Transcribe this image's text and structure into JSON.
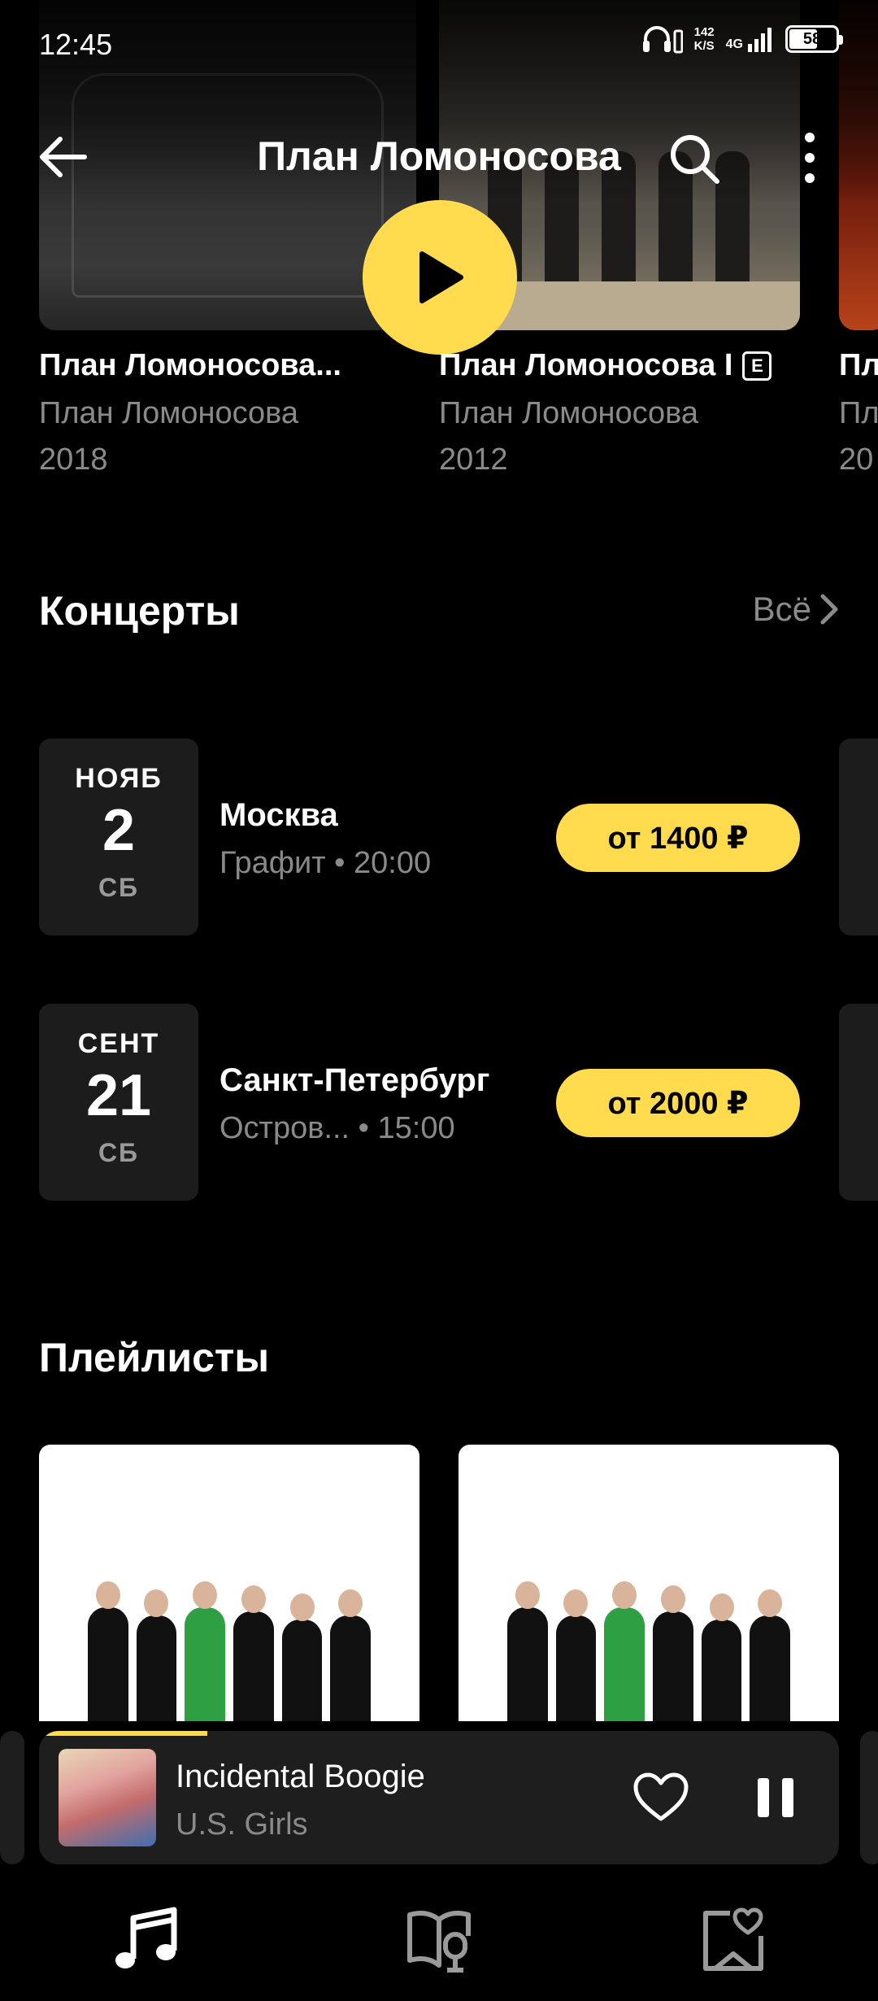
{
  "status_bar": {
    "time": "12:45",
    "speed_value": "142",
    "speed_unit": "K/S",
    "network": "4G",
    "battery": "58"
  },
  "header": {
    "title": "План Ломоносова"
  },
  "albums": [
    {
      "title": "План Ломоносова...",
      "artist": "План Ломоносова",
      "year": "2018",
      "explicit": false
    },
    {
      "title": "План Ломоносова I",
      "artist": "План Ломоносова",
      "year": "2012",
      "explicit": true,
      "explicit_badge": "E"
    },
    {
      "title": "Пл",
      "artist": "Пл",
      "year": "20",
      "explicit": false
    }
  ],
  "concerts_section": {
    "title": "Концерты",
    "see_all": "Всё"
  },
  "concerts": [
    {
      "month": "НОЯБ",
      "day": "2",
      "weekday": "СБ",
      "city": "Москва",
      "venue": "Графит • 20:00",
      "price": "от 1400 ₽"
    },
    {
      "month": "СЕНТ",
      "day": "21",
      "weekday": "СБ",
      "city": "Санкт-Петербург",
      "venue": "Остров... • 15:00",
      "price": "от 2000 ₽"
    }
  ],
  "playlists_section": {
    "title": "Плейлисты"
  },
  "mini_player": {
    "title": "Incidental Boogie",
    "artist": "U.S. Girls",
    "progress": 0.21
  },
  "bottom_nav": {
    "items": [
      "music-icon",
      "podcasts-book-icon",
      "collection-heart-icon"
    ]
  },
  "colors": {
    "accent": "#ffdb4d",
    "background": "#000000",
    "secondary_text": "#8a8a8a",
    "card": "#1c1c1c"
  }
}
